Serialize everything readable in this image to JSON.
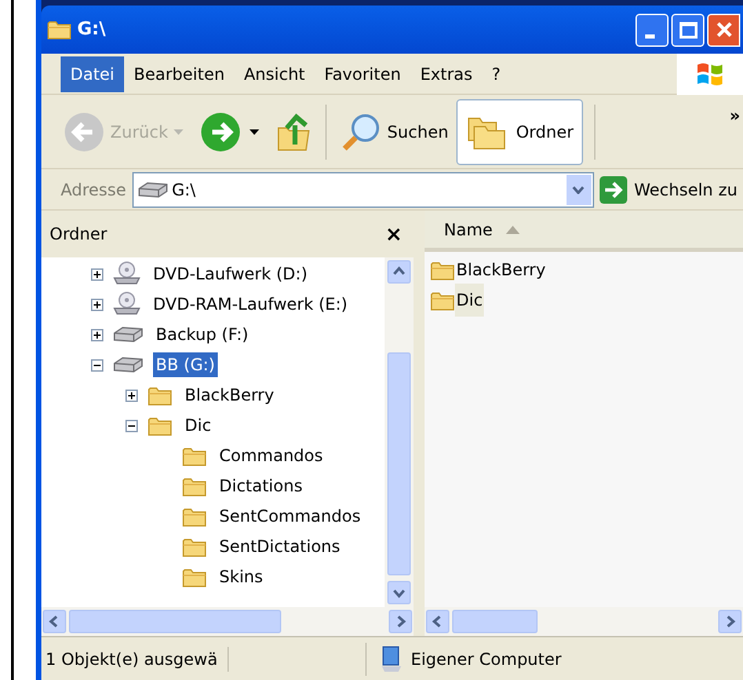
{
  "window": {
    "title": "G:\\"
  },
  "menu": [
    {
      "label": "Datei",
      "selected": true
    },
    {
      "label": "Bearbeiten",
      "selected": false
    },
    {
      "label": "Ansicht",
      "selected": false
    },
    {
      "label": "Favoriten",
      "selected": false
    },
    {
      "label": "Extras",
      "selected": false
    },
    {
      "label": "?",
      "selected": false
    }
  ],
  "toolbar": [
    {
      "kind": "back",
      "label": "Zurück",
      "disabled": true
    },
    {
      "kind": "forward",
      "disabled": false
    },
    {
      "kind": "up",
      "disabled": false
    },
    {
      "kind": "search",
      "label": "Suchen",
      "disabled": false
    },
    {
      "kind": "folders",
      "label": "Ordner",
      "disabled": false,
      "selected": true
    }
  ],
  "toolbar_overflow": "»",
  "address": {
    "label": "Adresse",
    "value": "G:\\",
    "go": "Wechseln zu"
  },
  "folders_pane": {
    "title": "Ordner",
    "close": "×",
    "tree": [
      {
        "label": "DVD-Laufwerk (D:)",
        "kind": "cdrom",
        "expanded": false,
        "selected": false
      },
      {
        "label": "DVD-RAM-Laufwerk (E:)",
        "kind": "cdrom",
        "expanded": false,
        "selected": false
      },
      {
        "label": "Backup (F:)",
        "kind": "drive",
        "expanded": false,
        "selected": false
      },
      {
        "label": "BB (G:)",
        "kind": "drive",
        "expanded": true,
        "selected": true,
        "children": [
          {
            "label": "BlackBerry",
            "kind": "folder",
            "expanded": false,
            "selected": false
          },
          {
            "label": "Dic",
            "kind": "folder",
            "expanded": true,
            "selected": false,
            "children": [
              {
                "label": "Commandos",
                "kind": "folder",
                "selected": false
              },
              {
                "label": "Dictations",
                "kind": "folder",
                "selected": false
              },
              {
                "label": "SentCommandos",
                "kind": "folder",
                "selected": false
              },
              {
                "label": "SentDictations",
                "kind": "folder",
                "selected": false
              },
              {
                "label": "Skins",
                "kind": "folder",
                "selected": false
              }
            ]
          }
        ]
      }
    ]
  },
  "file_list": {
    "columns": [
      "Name"
    ],
    "items": [
      {
        "name": "BlackBerry",
        "selected": false
      },
      {
        "name": "Dic",
        "selected": true
      }
    ]
  },
  "status_bar": {
    "selection": "1 Objekt(e) ausgewä",
    "zone": "Eigener Computer"
  }
}
